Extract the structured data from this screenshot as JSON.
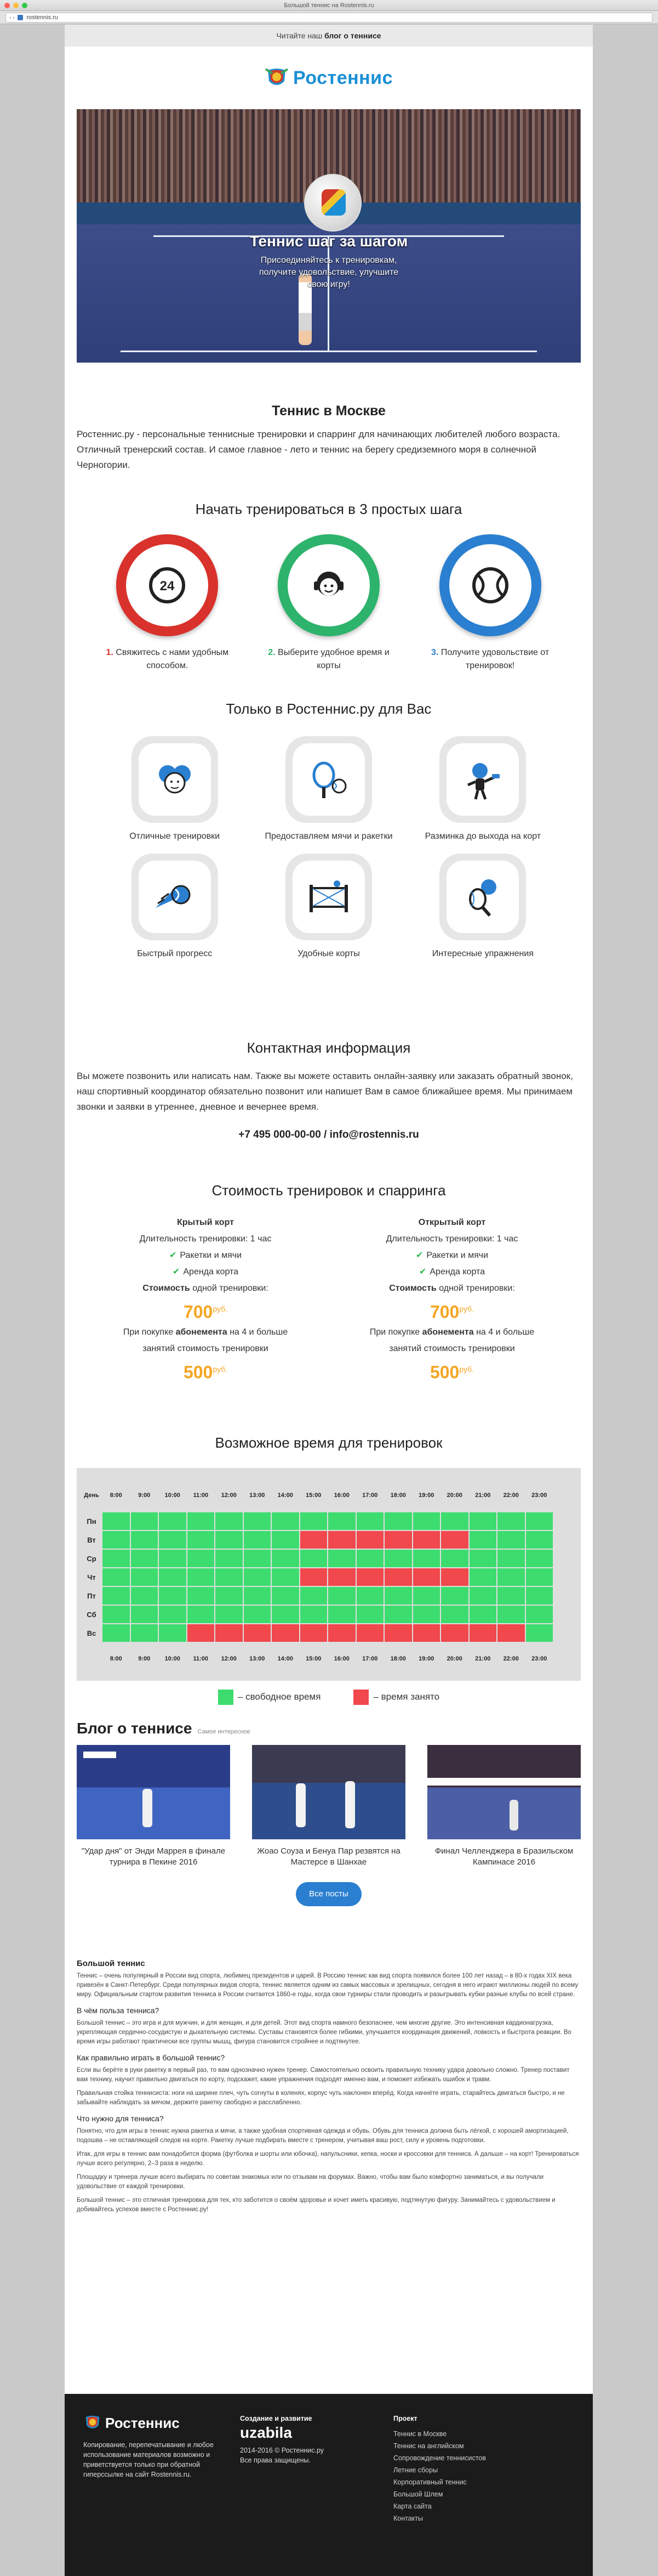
{
  "browser": {
    "tab_title": "Большой теннис на Rostennis.ru",
    "url": "rostennis.ru",
    "traffic_lights": [
      "#fc605c",
      "#fdbc40",
      "#34c84a"
    ]
  },
  "topbar": {
    "prefix": "Читайте наш ",
    "link": "блог о теннисе"
  },
  "logo": {
    "text": "Ростеннис"
  },
  "hero": {
    "title": "Теннис шаг за шагом",
    "subtitle_lines": [
      "Присоединяйтесь к тренировкам,",
      "получите удовольствие, улучшите",
      "свою игру!"
    ]
  },
  "about": {
    "title": "Теннис в Москве",
    "text": "Ростеннис.ру - персональные теннисные тренировки и спарринг для начинающих любителей любого возраста. Отличный тренерский состав. И самое главное - лето и теннис на берегу средиземного моря в солнечной Черногории."
  },
  "steps": {
    "title": "Начать тренироваться в 3 простых шага",
    "items": [
      {
        "num": "1.",
        "text": "Свяжитесь с нами удобным способом.",
        "color": "#d9312b",
        "icon": "phone-24-icon"
      },
      {
        "num": "2.",
        "text": "Выберите удобное время и корты",
        "color": "#2db36b",
        "icon": "operator-icon"
      },
      {
        "num": "3.",
        "text": "Получите удовольствие от тренировок!",
        "color": "#2a7fd0",
        "icon": "tennis-ball-icon"
      }
    ]
  },
  "features": {
    "title": "Только в Ростеннис.ру для Вас",
    "items": [
      {
        "label": "Отличные тренировки",
        "icon": "coaches-icon"
      },
      {
        "label": "Предоставляем мячи и ракетки",
        "icon": "racket-balls-icon"
      },
      {
        "label": "Разминка до выхода на корт",
        "icon": "warmup-icon"
      },
      {
        "label": "Быстрый прогресс",
        "icon": "fast-ball-icon"
      },
      {
        "label": "Удобные корты",
        "icon": "court-net-icon"
      },
      {
        "label": "Интересные упражнения",
        "icon": "exercise-racket-icon"
      }
    ]
  },
  "contact": {
    "title": "Контактная информация",
    "text": "Вы можете позвонить или написать нам. Также вы можете оставить онлайн-заявку или заказать обратный звонок, наш спортивный координатор обязательно позвонит или напишет Вам в самое ближайшее время. Мы принимаем звонки и заявки в утреннее, дневное и вечернее время.",
    "phone_line": "+7 495 000-00-00 / info@rostennis.ru"
  },
  "pricing": {
    "title": "Стоимость тренировок и спарринга",
    "plans": [
      {
        "name": "Крытый корт",
        "duration": "Длительность тренировки: 1 час",
        "features": [
          "Ракетки и мячи",
          "Аренда корта"
        ],
        "single_label": "Стоимость",
        "single_rest": " одной тренировки:",
        "single_price": "700",
        "currency": "руб.",
        "sub_line1_a": "При покупке ",
        "sub_line1_b": "абонемента",
        "sub_line1_c": " на 4 и больше",
        "sub_line2": "занятий стоимость тренировки",
        "sub_price": "500"
      },
      {
        "name": "Открытый корт",
        "duration": "Длительность тренировки: 1 час",
        "features": [
          "Ракетки и мячи",
          "Аренда корта"
        ],
        "single_label": "Стоимость",
        "single_rest": " одной тренировки:",
        "single_price": "700",
        "currency": "руб.",
        "sub_line1_a": "При покупке ",
        "sub_line1_b": "абонемента",
        "sub_line1_c": " на 4 и больше",
        "sub_line2": "занятий стоимость тренировки",
        "sub_price": "500"
      }
    ]
  },
  "schedule": {
    "title": "Возможное время для тренировок",
    "day_header": "День",
    "hours": [
      "8:00",
      "9:00",
      "10:00",
      "11:00",
      "12:00",
      "13:00",
      "14:00",
      "15:00",
      "16:00",
      "17:00",
      "18:00",
      "19:00",
      "20:00",
      "21:00",
      "22:00",
      "23:00"
    ],
    "days": [
      "Пн",
      "Вт",
      "Ср",
      "Чт",
      "Пт",
      "Сб",
      "Вс"
    ],
    "busy": {
      "Вт": [
        "15:00",
        "16:00",
        "17:00",
        "18:00",
        "19:00",
        "20:00"
      ],
      "Чт": [
        "15:00",
        "16:00",
        "17:00",
        "18:00",
        "19:00",
        "20:00"
      ],
      "Вс": [
        "11:00",
        "12:00",
        "13:00",
        "14:00",
        "15:00",
        "16:00",
        "17:00",
        "18:00",
        "19:00",
        "20:00",
        "21:00",
        "22:00"
      ]
    },
    "colors": {
      "free": "#3ddc6e",
      "busy": "#f0484c"
    },
    "legend_free": "– свободное время",
    "legend_busy": "– время занято"
  },
  "blog": {
    "title": "Блог о теннисе",
    "subtitle": "Самое интересное",
    "posts": [
      {
        "title": "\"Удар дня\" от Энди Маррея в финале турнира в Пекине 2016"
      },
      {
        "title": "Жоао Соуза и Бенуа Пар резвятся на Мастерсе в Шанхае"
      },
      {
        "title": "Финал Челленджера в Бразильском Кампинасе 2016"
      }
    ],
    "all_posts_button": "Все посты"
  },
  "article": {
    "h1": "Большой теннис",
    "p1": "Теннис – очень популярный в России вид спорта, любимец президентов и царей. В Россию теннис как вид спорта появился более 100 лет назад – в 80-х годах XIX века привезён в Санкт-Петербург. Среди популярных видов спорта, теннис является одним из самых массовых и зрелищных, сегодня в него играют миллионы людей по всему миру. Официальным стартом развития тенниса в России считается 1860-е годы, когда свои турниры стали проводить и разыгрывать кубки разные клубы по всей стране.",
    "h2": "В чём польза тенниса?",
    "p2": "Большой теннис – это игра и для мужчин, и для женщин, и для детей. Этот вид спорта намного безопаснее, чем многие другие. Это интенсивная кардионагрузка, укрепляющая сердечно-сосудистую и дыхательную системы. Суставы становятся более гибкими, улучшается координация движений, ловкость и быстрота реакции. Во время игры работают практически все группы мышц, фигура становится стройнее и подтянутее.",
    "h3": "Как правильно играть в большой теннис?",
    "p3": "Если вы берёте в руки ракетку в первый раз, то вам однозначно нужен тренер. Самостоятельно освоить правильную технику удара довольно сложно. Тренер поставит вам технику, научит правильно двигаться по корту, подскажет, какие упражнения подходят именно вам, и поможет избежать ошибок и травм.",
    "p4": "Правильная стойка теннисиста: ноги на ширине плеч, чуть согнуты в коленях, корпус чуть наклонен вперёд. Когда начнёте играть, старайтесь двигаться быстро, и не забывайте наблюдать за мячом, держите ракетку свободно и расслабленно.",
    "h4": "Что нужно для тенниса?",
    "p5": "Понятно, что для игры в теннис нужна ракетка и мячи, а также удобная спортивная одежда и обувь. Обувь для тенниса должна быть лёгкой, с хорошей амортизацией, подошва – не оставляющей следов на корте. Ракетку лучше подбирать вместе с тренером, учитывая ваш рост, силу и уровень подготовки.",
    "p6": "Итак, для игры в теннис вам понадобится форма (футболка и шорты или юбочка), напульсники, кепка, носки и кроссовки для тенниса. А дальше – на корт! Тренироваться лучше всего регулярно, 2–3 раза в неделю.",
    "p7": "Площадку и тренера лучше всего выбирать по советам знакомых или по отзывам на форумах. Важно, чтобы вам было комфортно заниматься, и вы получали удовольствие от каждой тренировки.",
    "p8": "Большой теннис – это отличная тренировка для тех, кто заботится о своём здоровье и хочет иметь красивую, подтянутую фигуру. Занимайтесь с удовольствием и добивайтесь успехов вместе с Ростеннис.ру!"
  },
  "footer": {
    "logo": "Ростеннис",
    "copyright": "Копирование, перепечатывание и любое использование материалов возможно и приветствуется только при обратной гиперссылке на сайт Rostennis.ru.",
    "created_label": "Создание и развитие",
    "agency": "uzabila",
    "years": "2014-2016 © Ростеннис.ру",
    "rights": "Все права защищены.",
    "project_title": "Проект",
    "project_links": [
      "Теннис в Москве",
      "Теннис на английском",
      "Сопровождение теннисистов",
      "Летние сборы",
      "Корпоративный теннис",
      "Большой Шлем",
      "Карта сайта",
      "Контакты"
    ]
  }
}
